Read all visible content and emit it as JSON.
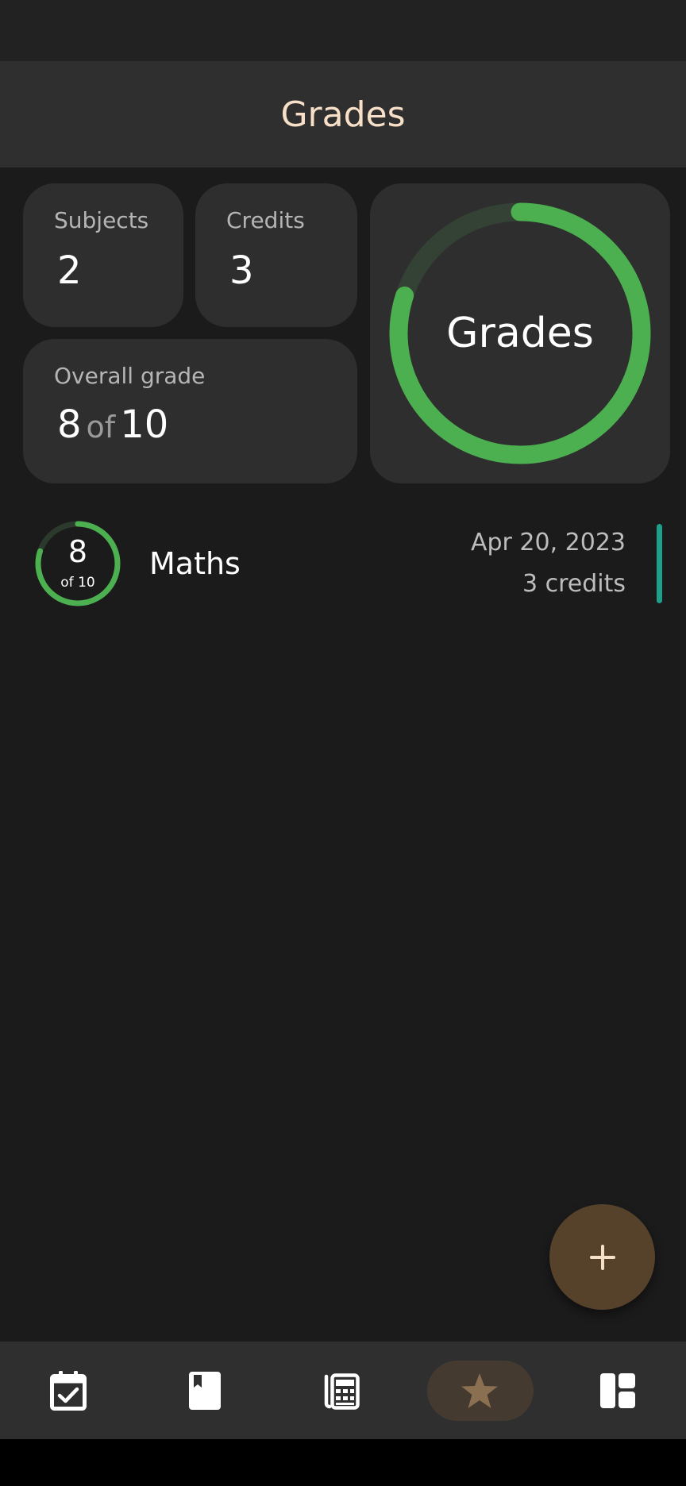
{
  "app_bar": {
    "title": "Grades"
  },
  "stats": {
    "subjects": {
      "label": "Subjects",
      "value": "2"
    },
    "credits": {
      "label": "Credits",
      "value": "3"
    },
    "overall": {
      "label": "Overall grade",
      "value": "8",
      "of": "of",
      "max": "10"
    }
  },
  "summary_ring": {
    "label": "Grades",
    "progress": 0.8
  },
  "grades_list": [
    {
      "grade": "8",
      "of_text": "of 10",
      "progress": 0.8,
      "subject": "Maths",
      "date": "Apr 20, 2023",
      "credits": "3 credits"
    }
  ],
  "fab": {
    "icon": "plus-icon"
  },
  "bottom_nav": {
    "items": [
      {
        "icon": "calendar-check-icon"
      },
      {
        "icon": "book-icon"
      },
      {
        "icon": "calculator-icon"
      },
      {
        "icon": "star-icon",
        "selected": true
      },
      {
        "icon": "dashboard-icon"
      }
    ]
  },
  "colors": {
    "accent_green": "#4caf50",
    "accent_teal": "#1e9f8a",
    "title_peach": "#f7dfc8",
    "fab_brown": "#56422b"
  }
}
